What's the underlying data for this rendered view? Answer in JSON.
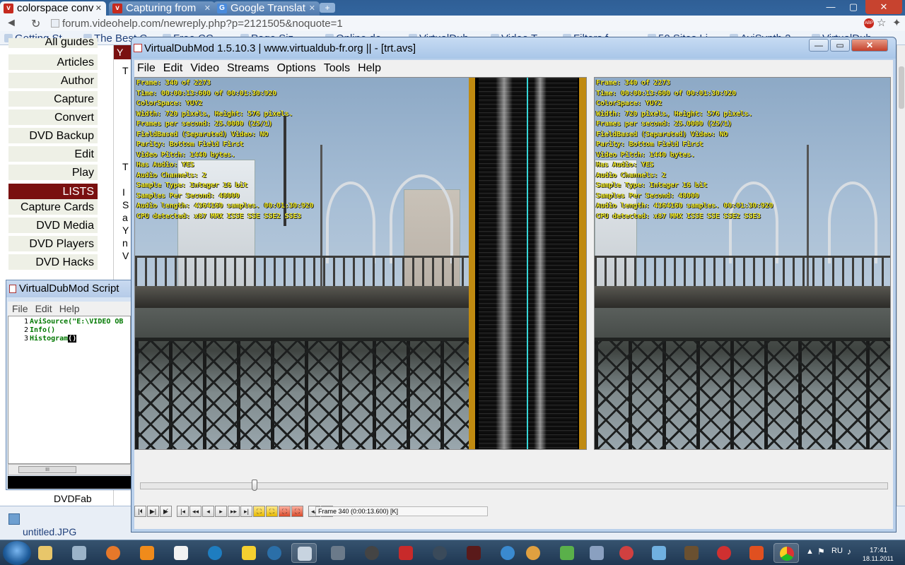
{
  "browser": {
    "tabs": [
      {
        "title": "colorspace conv",
        "active": true
      },
      {
        "title": "Capturing from",
        "active": false
      },
      {
        "title": "Google Translat",
        "active": false
      }
    ],
    "new_tab": "+",
    "url": "forum.videohelp.com/newreply.php?p=2121505&noquote=1",
    "back": "◄",
    "reload": "↻",
    "abp_badge": "ABP",
    "wrench": "✦",
    "bookmarks": [
      "Getting St...",
      "The Best C...",
      "Free CC...",
      "Page Siz...",
      "Online de...",
      "VirtualDub...",
      "Video T...",
      "Filters f...",
      "50 Sites Li...",
      "AviSynth 2...",
      "VirtualDub..."
    ],
    "window_controls": {
      "min": "—",
      "max": "▢",
      "close": "✕"
    }
  },
  "page": {
    "menu_partial": "All guides",
    "menu": [
      "Articles",
      "Author",
      "Capture",
      "Convert",
      "DVD Backup",
      "Edit",
      "Play",
      "LISTS",
      "Capture Cards",
      "DVD Media",
      "DVD Players",
      "DVD Hacks"
    ],
    "strip_letters": [
      "Y",
      "T",
      "T",
      "I",
      "S",
      "a",
      "Y",
      "n",
      "V"
    ],
    "dvdfab": "DVDFab",
    "download": "untitled.JPG"
  },
  "script_editor": {
    "title": "VirtualDubMod Script",
    "menu": [
      "File",
      "Edit",
      "Help"
    ],
    "lines": [
      {
        "n": "1",
        "code": "AviSource(\"E:\\VIDEO OB"
      },
      {
        "n": "2",
        "code": "Info()"
      },
      {
        "n": "3",
        "code": "Histogram",
        "cursor": "()"
      }
    ],
    "scroll_glyph": "III"
  },
  "vdub": {
    "title": "VirtualDubMod 1.5.10.3 | www.virtualdub-fr.org || - [trt.avs]",
    "menu": [
      "File",
      "Edit",
      "Video",
      "Streams",
      "Options",
      "Tools",
      "Help"
    ],
    "controls": {
      "min": "—",
      "max": "▭",
      "close": "✕"
    },
    "input_info": [
      "Frame:      340 of 2273",
      "Time: 00:00:13:600 of 00:01:30:920",
      "ColorSpace: YUY2",
      "Width: 720 pixels, Height: 576 pixels.",
      "Frames per second: 25.0000 (25/1)",
      "FieldBased (Separated) Video: NO",
      "Parity: Bottom Field First",
      "Video Pitch:  1440 bytes.",
      "Has Audio: YES",
      "Audio Channels: 2",
      "Sample Type: Integer 16 bit",
      "Samples Per Second: 48000",
      "Audio length: 4364160 samples. 00:01:30:920",
      "CPU detected: x87  MMX  ISSE  SSE  SSE2 SSE3"
    ],
    "output_info": [
      "Frame:      340 of 2273",
      "Time: 00:00:13:600 of 00:01:30:920",
      "ColorSpace: YUY2",
      "Width: 720 pixels, Height: 576 pixels.",
      "Frames per second: 25.0000 (25/1)",
      "FieldBased (Separated) Video: NO",
      "Parity: Bottom Field First",
      "Video Pitch:  1440 bytes.",
      "Has Audio: YES",
      "Audio Channels: 2",
      "Sample Type: Integer 16 bit",
      "Samples Per Second: 48000",
      "Audio length: 4364160 samples. 00:01:30:920",
      "CPU detected: x87  MMX  ISSE  SSE  SSE2 SSE3"
    ],
    "position_fraction": 0.15,
    "toolbar": [
      "|⏴",
      "▶|",
      "▶̸",
      "|◂",
      "◂◂",
      "◂",
      "▸",
      "▸▸",
      "▸|",
      "⛶",
      "⛶",
      "⛶",
      "⛶",
      "◂▴",
      "▴▸"
    ],
    "frame_status": "Frame 340 (0:00:13.600) [K]"
  },
  "taskbar": {
    "apps": [
      "explorer",
      "device",
      "firefox",
      "rss",
      "calendar",
      "opera",
      "mail",
      "media-player",
      "virtualdub",
      "settings",
      "recorder",
      "app-red",
      "converter",
      "app-dark",
      "media",
      "ball",
      "puzzle",
      "cursor",
      "tool",
      "cube",
      "painting",
      "ball-red",
      "tool-x",
      "chrome"
    ],
    "tray": {
      "lang": "RU",
      "time": "17:41",
      "date": "18.11.2011"
    }
  },
  "colors": {
    "accent_red": "#7a1010",
    "overlay_yellow": "#f3ee2a",
    "histogram_band": "#c08a10",
    "histogram_center": "#35d6d8"
  }
}
